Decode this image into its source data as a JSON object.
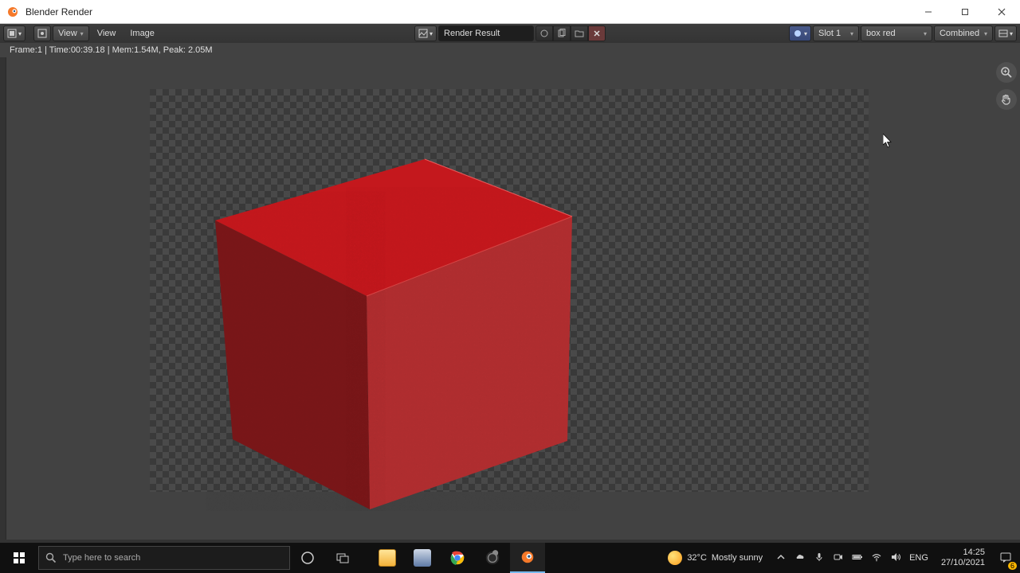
{
  "window": {
    "title": "Blender Render"
  },
  "toolbar": {
    "view1": "View",
    "view2": "View",
    "image_menu": "Image",
    "center_label": "Render Result",
    "slot": "Slot 1",
    "layer": "box red",
    "pass": "Combined"
  },
  "status": {
    "line": "Frame:1 | Time:00:39.18 | Mem:1.54M, Peak: 2.05M"
  },
  "taskbar": {
    "search_placeholder": "Type here to search",
    "weather_temp": "32°C",
    "weather_desc": "Mostly sunny",
    "lang": "ENG",
    "time": "14:25",
    "date": "27/10/2021",
    "notif_count": "6"
  }
}
